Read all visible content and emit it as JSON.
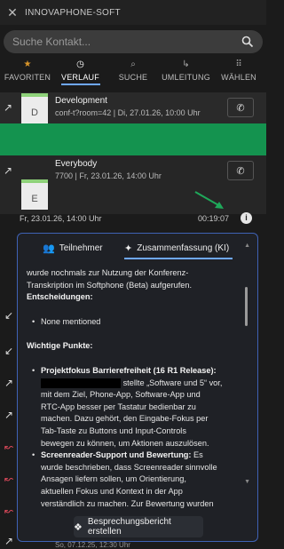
{
  "app": {
    "title": "INNOVAPHONE-SOFT"
  },
  "search": {
    "placeholder": "Suche Kontakt..."
  },
  "nav": {
    "tabs": [
      {
        "label": "FAVORITEN",
        "icon": "star-icon"
      },
      {
        "label": "VERLAUF",
        "icon": "history-icon",
        "active": true
      },
      {
        "label": "SUCHE",
        "icon": "search-icon"
      },
      {
        "label": "UMLEITUNG",
        "icon": "forward-icon"
      },
      {
        "label": "WÄHLEN",
        "icon": "dialpad-icon"
      }
    ]
  },
  "history": {
    "items": [
      {
        "avatar": "D",
        "name": "Development",
        "detail": "conf-t?room=42 | Di, 27.01.26, 10:00 Uhr"
      },
      {
        "avatar": "E",
        "name": "Everybody",
        "detail": "7700 | Fr, 23.01.26, 14:00 Uhr"
      }
    ],
    "selected_meta": {
      "date": "Fr, 23.01.26, 14:00 Uhr",
      "duration": "00:19:07"
    },
    "bottom_date": "So, 07.12.25, 12:30 Uhr"
  },
  "panel": {
    "tabs": [
      {
        "label": "Teilnehmer",
        "icon": "participants-icon"
      },
      {
        "label": "Zusammenfassung (KI)",
        "icon": "sparkle-icon",
        "active": true
      }
    ],
    "lines": {
      "l1": "wurde nochmals zur Nutzung der Konferenz-",
      "l2": "Transkription im Softphone (Beta) aufgerufen.",
      "decisions_heading": "Entscheidungen:",
      "decision_1": "None mentioned",
      "points_heading": "Wichtige Punkte:",
      "p1_title": "Projektfokus Barrierefreiheit (16 R1 Release):",
      "p1_l2_rest": "stellte „Software und 5“ vor,",
      "p1_l3": "mit dem Ziel, Phone-App, Software-App und",
      "p1_l4": "RTC-App besser per Tastatur bedienbar zu",
      "p1_l5": "machen. Dazu gehört, den Eingabe-Fokus per",
      "p1_l6": "Tab-Taste zu Buttons und Input-Controls",
      "p1_l7": "bewegen zu können, um Aktionen auszulösen.",
      "p2_title": "Screenreader-Support und Bewertung:",
      "p2_title_rest": "Es",
      "p2_l2": "wurde beschrieben, dass Screenreader sinnvolle",
      "p2_l3": "Ansagen liefern sollen, um Orientierung,",
      "p2_l4": "aktuellen Fokus und Kontext in der App",
      "p2_l5": "verständlich zu machen. Zur Bewertung wurden"
    },
    "report_button": "Besprechungsbericht erstellen"
  },
  "colors": {
    "accent": "#6fa8ff",
    "green_bar": "#14934f",
    "panel_border": "#3f62b5",
    "missed": "#e04a5c"
  }
}
